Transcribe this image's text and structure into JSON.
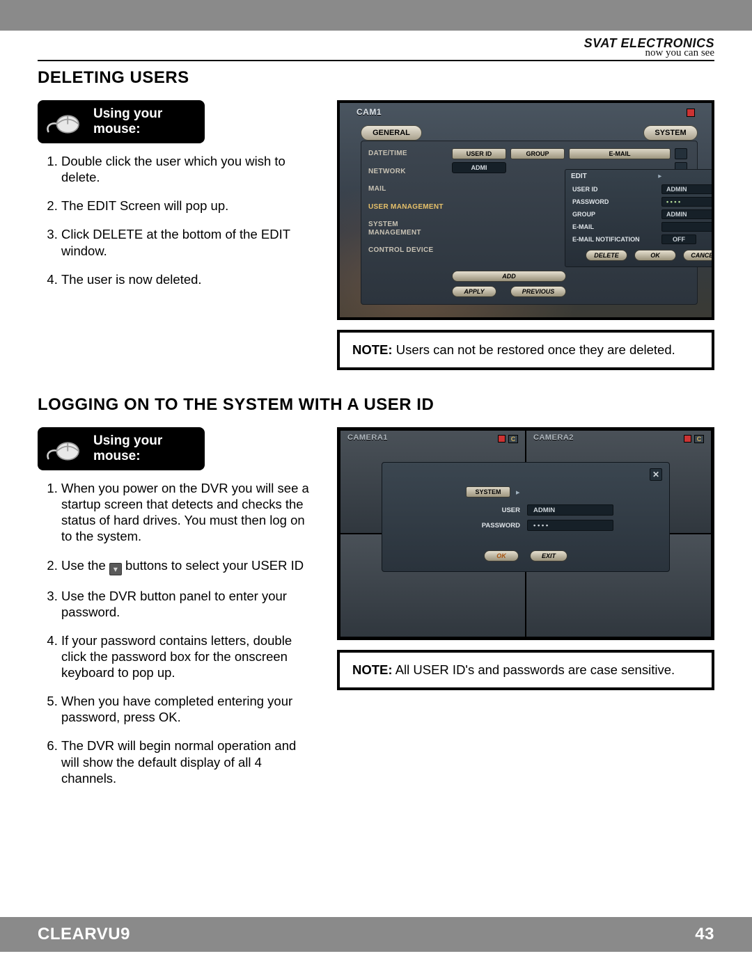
{
  "brand": {
    "name": "SVAT ELECTRONICS",
    "tagline": "now you can see"
  },
  "section1": {
    "title": "DELETING USERS",
    "mouse_label": "Using your mouse:",
    "steps": [
      "Double click the user which you wish to delete.",
      "The EDIT Screen will pop up.",
      "Click DELETE at the bottom of the EDIT window.",
      "The user is now deleted."
    ],
    "note_label": "NOTE:",
    "note_text": "Users can not be restored once they are deleted."
  },
  "shot1": {
    "cam": "CAM1",
    "tab_general": "GENERAL",
    "tab_system": "SYSTEM",
    "side_items": [
      "DATE/TIME",
      "NETWORK",
      "MAIL",
      "USER MANAGEMENT",
      "SYSTEM MANAGEMENT",
      "CONTROL DEVICE"
    ],
    "side_active_index": 3,
    "table_headers": [
      "USER ID",
      "GROUP",
      "E-MAIL"
    ],
    "table_row0": {
      "user_id": "ADMI"
    },
    "edit": {
      "title": "EDIT",
      "fields": {
        "user_id_label": "USER ID",
        "user_id_value": "ADMIN",
        "password_label": "PASSWORD",
        "group_label": "GROUP",
        "group_value": "ADMIN",
        "email_label": "E-MAIL",
        "email_notif_label": "E-MAIL NOTIFICATION",
        "email_notif_value": "OFF"
      },
      "buttons": {
        "delete": "DELETE",
        "ok": "OK",
        "cancel": "CANCEL"
      }
    },
    "lower_buttons": {
      "add": "ADD",
      "apply": "APPLY",
      "previous": "PREVIOUS"
    }
  },
  "section2": {
    "title": "LOGGING ON TO THE SYSTEM WITH A USER ID",
    "mouse_label": "Using your mouse:",
    "steps": [
      "When you power on the DVR you will see a startup screen that detects and checks the status of hard drives. You must then log on to the system.",
      {
        "pre": "Use the ",
        "post": " buttons to select your USER ID"
      },
      "Use the DVR button panel to enter your password.",
      "If your password contains letters, double click the password box for the onscreen keyboard to pop up.",
      "When you have completed entering your password, press OK.",
      "The DVR will begin normal operation and will show the default display of all 4 channels."
    ],
    "note_label": "NOTE:",
    "note_text": "All USER ID's and passwords are case sensitive."
  },
  "shot2": {
    "cam1": "CAMERA1",
    "cam2": "CAMERA2",
    "badge": "C",
    "login": {
      "system_label": "SYSTEM",
      "user_label": "USER",
      "user_value": "ADMIN",
      "password_label": "PASSWORD",
      "password_value": "• • • •",
      "ok": "OK",
      "exit": "EXIT"
    }
  },
  "footer": {
    "product": "CLEARVU9",
    "page": "43"
  }
}
